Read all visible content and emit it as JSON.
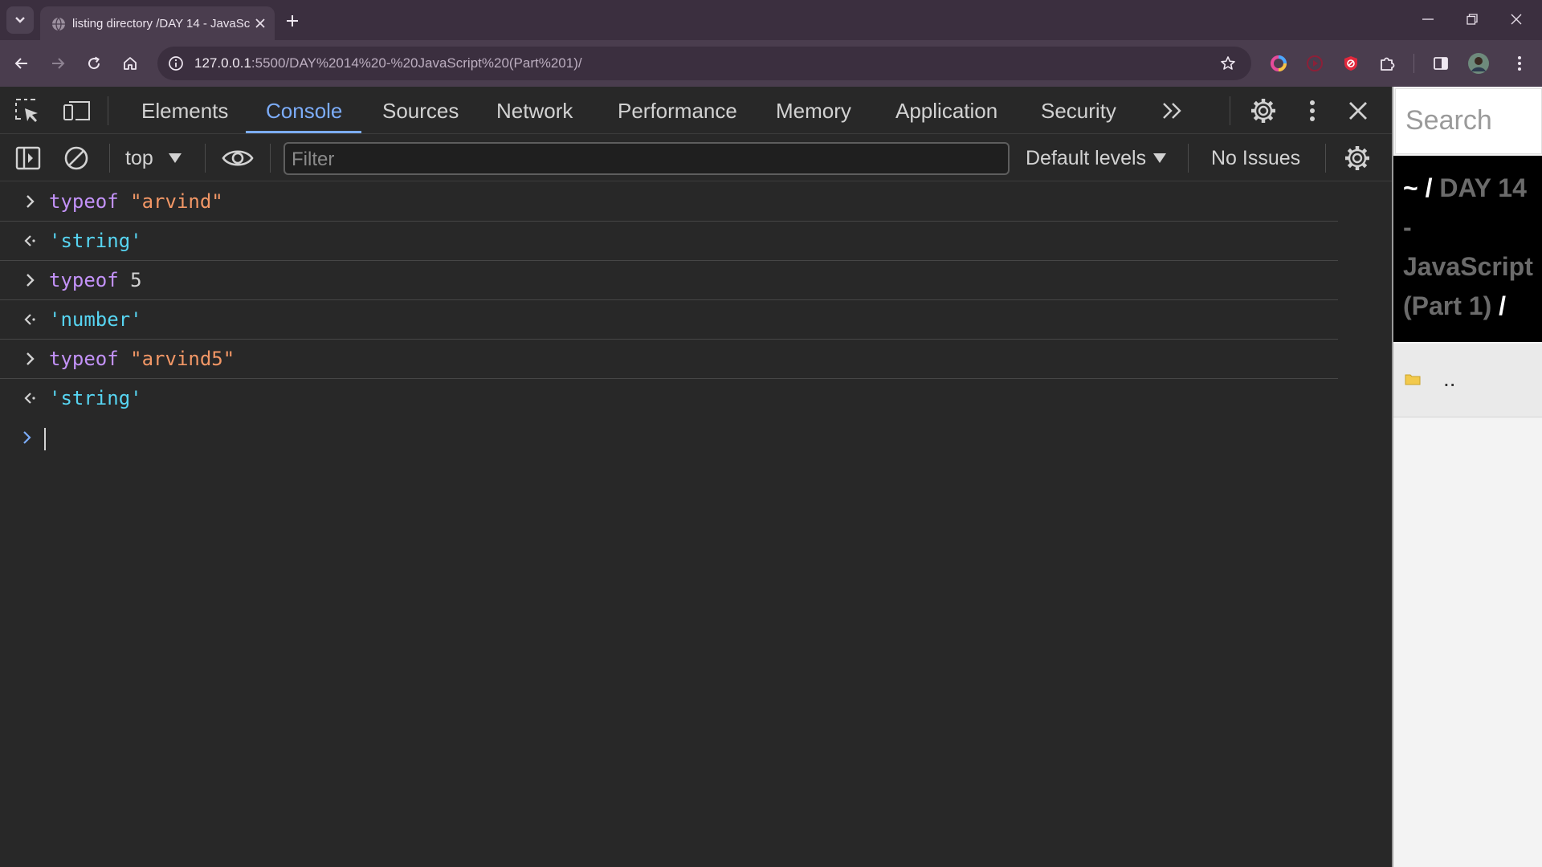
{
  "browser": {
    "tab_title": "listing directory /DAY 14 - JavaScript (Part 1)/",
    "url_host": "127.0.0.1",
    "url_path": ":5500/DAY%2014%20-%20JavaScript%20(Part%201)/"
  },
  "devtools": {
    "tabs": [
      "Elements",
      "Console",
      "Sources",
      "Network",
      "Performance",
      "Memory",
      "Application",
      "Security"
    ],
    "active_tab": "Console",
    "console_toolbar": {
      "context": "top",
      "filter_placeholder": "Filter",
      "levels": "Default levels",
      "issues": "No Issues"
    },
    "console": {
      "entries": [
        {
          "kind": "input",
          "keyword": "typeof",
          "arg": "\"arvind\""
        },
        {
          "kind": "output",
          "text": "'string'"
        },
        {
          "kind": "input",
          "keyword": "typeof",
          "arg": "5"
        },
        {
          "kind": "output",
          "text": "'number'"
        },
        {
          "kind": "input",
          "keyword": "typeof",
          "arg": "\"arvind5\""
        },
        {
          "kind": "output",
          "text": "'string'"
        }
      ]
    }
  },
  "page": {
    "search_placeholder": "Search",
    "path": {
      "home": "~",
      "sep": "/",
      "folder": "DAY 14 - JavaScript (Part 1)"
    },
    "files": [
      {
        "name": ".."
      }
    ]
  },
  "colors": {
    "keyword": "#c392f8",
    "string": "#f29766",
    "result": "#57d5f2",
    "accent": "#7cacf8"
  }
}
